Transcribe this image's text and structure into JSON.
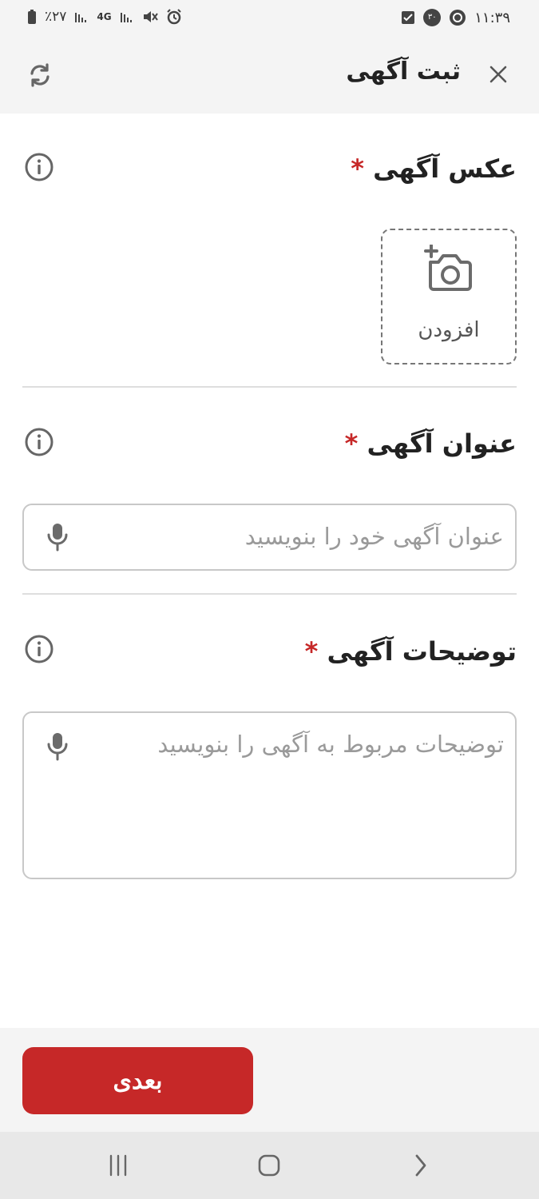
{
  "status_bar": {
    "time": "۱۱:۳۹",
    "notification_count": "۳۰",
    "battery": "٪۲۷",
    "network": "4G"
  },
  "header": {
    "title": "ثبت آگهی",
    "close_icon": "close-icon",
    "refresh_icon": "refresh-icon"
  },
  "photo_section": {
    "title": "عکس آگهی",
    "required_mark": "*",
    "add_label": "افزودن"
  },
  "title_section": {
    "title": "عنوان آگهی",
    "required_mark": "*",
    "placeholder": "عنوان آگهی خود را بنویسید"
  },
  "description_section": {
    "title": "توضیحات آگهی",
    "required_mark": "*",
    "placeholder": "توضیحات مربوط به آگهی را بنویسید"
  },
  "footer": {
    "next_label": "بعدی"
  },
  "colors": {
    "accent": "#c62828",
    "placeholder": "#9a9a9a",
    "surface": "#f4f4f4"
  }
}
